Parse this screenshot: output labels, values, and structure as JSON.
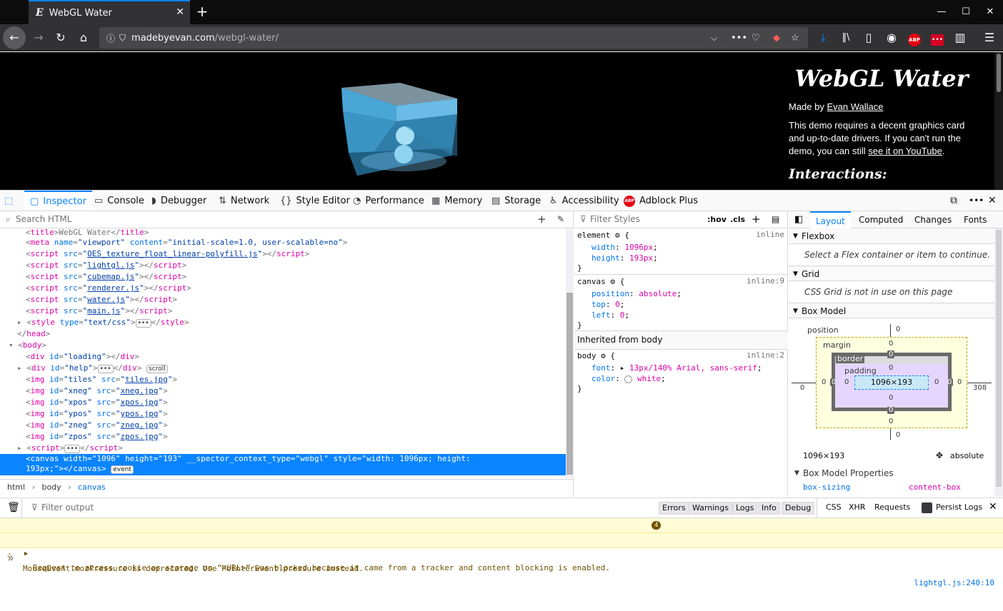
{
  "browser": {
    "tab_title": "WebGL Water",
    "tab_favicon": "E",
    "tab_close": "✕",
    "new_tab": "+",
    "window_controls": [
      "—",
      "☐",
      "✕"
    ],
    "url_host": "madebyevan.com",
    "url_path": "/webgl-water/"
  },
  "page": {
    "title": "WebGL Water",
    "made_by_prefix": "Made by ",
    "author": "Evan Wallace",
    "desc_1": "This demo requires a decent graphics card and up-to-date drivers. If you can't run the demo, you can still ",
    "desc_link": "see it on YouTube",
    "desc_2": ".",
    "interactions": "Interactions:"
  },
  "devtools": {
    "tabs": [
      "Inspector",
      "Console",
      "Debugger",
      "Network",
      "Style Editor",
      "Performance",
      "Memory",
      "Storage",
      "Accessibility",
      "Adblock Plus"
    ],
    "search_placeholder": "Search HTML",
    "breadcrumbs": [
      "html",
      "body",
      "canvas"
    ],
    "rules_filter_placeholder": "Filter Styles",
    "hov": ":hov",
    "cls": ".cls",
    "layout_tabs": [
      "Layout",
      "Computed",
      "Changes",
      "Fonts"
    ],
    "flexbox": "Flexbox",
    "flexbox_msg": "Select a Flex container or item to continue.",
    "grid": "Grid",
    "grid_msg": "CSS Grid is not in use on this page",
    "box_model": "Box Model",
    "box_model_props": "Box Model Properties",
    "bm": {
      "position": "position",
      "margin": "margin",
      "border": "border",
      "padding": "padding",
      "content": "1096×193",
      "size": "1096×193",
      "pos_val": "absolute",
      "pos_top": "0",
      "pos_left": "0",
      "pos_right": "308",
      "pos_bottom": "0",
      "zero": "0"
    },
    "box_sizing_prop": "box-sizing",
    "box_sizing_val": "content-box",
    "rules": {
      "element_sel": "element",
      "element_src": "inline",
      "element_props": [
        [
          "width",
          "1096px"
        ],
        [
          "height",
          "193px"
        ]
      ],
      "canvas_sel": "canvas",
      "canvas_src": "inline:9",
      "canvas_props": [
        [
          "position",
          "absolute"
        ],
        [
          "top",
          "0"
        ],
        [
          "left",
          "0"
        ]
      ],
      "inherited": "Inherited from body",
      "body_sel": "body",
      "body_src": "inline:2",
      "body_props": [
        [
          "font",
          "13px/140% Arial, sans-serif"
        ],
        [
          "color",
          "white"
        ]
      ]
    }
  },
  "console": {
    "filter_placeholder": "Filter output",
    "levels": [
      "Errors",
      "Warnings",
      "Logs",
      "Info",
      "Debug"
    ],
    "types": [
      "CSS",
      "XHR",
      "Requests"
    ],
    "persist": "Persist Logs",
    "messages": [
      {
        "text": "Request to access cookie or storage on “<URL>” was blocked because it came from a tracker and content blocking is enabled.",
        "count": "4",
        "source": ""
      },
      {
        "text": "MouseEvent.mozPressure is deprecated. Use PointerEvent.pressure instead.",
        "count": "",
        "source": "lightgl.js:240:10"
      }
    ],
    "prompt": "»"
  },
  "colors": {
    "accent": "#0a84ff",
    "tag": "#dd00a9",
    "attr": "#0074e8",
    "warn_bg": "#fffbd6"
  }
}
